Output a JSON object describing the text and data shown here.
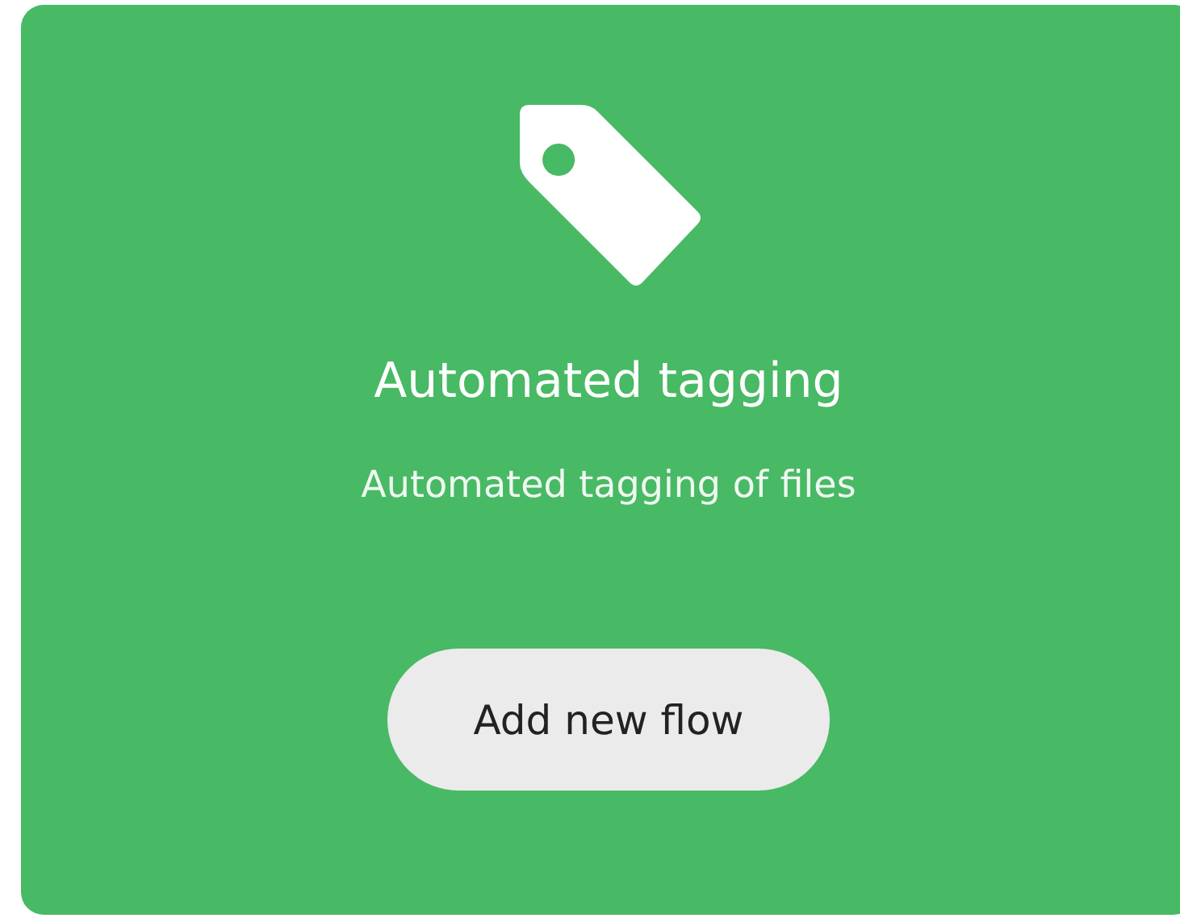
{
  "card": {
    "title": "Automated tagging",
    "description": "Automated tagging of files",
    "button": "Add new flow"
  }
}
